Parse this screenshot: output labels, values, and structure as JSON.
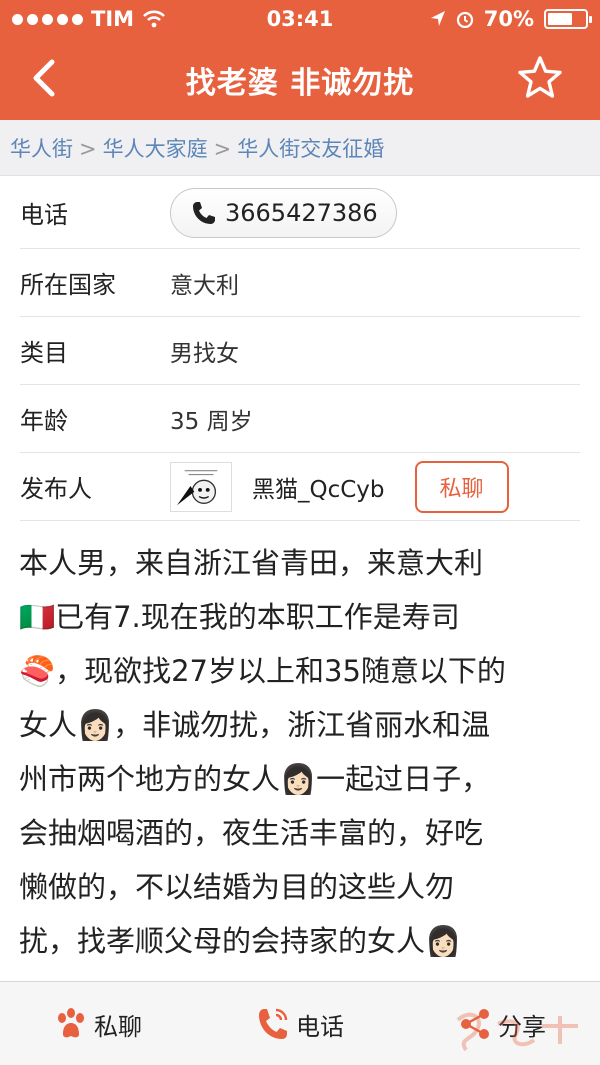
{
  "status_bar": {
    "carrier": "TIM",
    "time": "03:41",
    "battery_text": "70%",
    "battery_level": 0.7
  },
  "nav": {
    "title": "找老婆  非诚勿扰",
    "back_icon": "back-chevron-icon",
    "favorite_icon": "star-outline-icon"
  },
  "breadcrumb": {
    "items": [
      "华人街",
      "华人大家庭",
      "华人街交友征婚"
    ],
    "separator": ">"
  },
  "details": {
    "phone_label": "电话",
    "phone_number": "3665427386",
    "country_label": "所在国家",
    "country_value": "意大利",
    "category_label": "类目",
    "category_value": "男找女",
    "age_label": "年龄",
    "age_value": "35 周岁",
    "publisher_label": "发布人",
    "publisher_name": "黑猫_QcCyb",
    "chat_button": "私聊"
  },
  "description": {
    "lines": [
      "本人男，来自浙江省青田，来意大利",
      "🇮🇹已有7.现在我的本职工作是寿司",
      "🍣，现欲找27岁以上和35随意以下的",
      "女人👩🏻，非诚勿扰，浙江省丽水和温",
      "州市两个地方的女人👩🏻一起过日子，",
      "会抽烟喝酒的，夜生活丰富的，好吃",
      "懒做的，不以结婚为目的这些人勿",
      "扰，找孝顺父母的会持家的女人👩🏻"
    ]
  },
  "bottom_bar": {
    "chat_label": "私聊",
    "call_label": "电话",
    "share_label": "分享"
  },
  "colors": {
    "brand": "#e8613f",
    "link": "#5d86b8"
  }
}
